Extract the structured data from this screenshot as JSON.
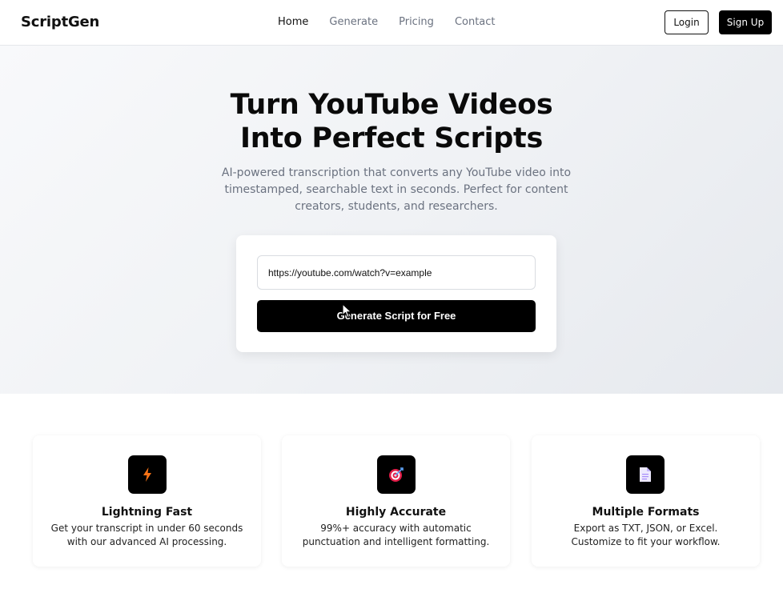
{
  "nav": {
    "brand": "ScriptGen",
    "links": [
      "Home",
      "Generate",
      "Pricing",
      "Contact"
    ],
    "active": "Home",
    "login_label": "Login",
    "signup_label": "Sign Up"
  },
  "hero": {
    "title_line1": "Turn YouTube Videos",
    "title_line2": "Into Perfect Scripts",
    "subtitle": "AI-powered transcription that converts any YouTube video into timestamped, searchable text in seconds. Perfect for content creators, students, and researchers.",
    "input_value": "https://youtube.com/watch?v=example",
    "generate_label": "Generate Script for Free"
  },
  "features": [
    {
      "icon": "lightning-icon",
      "title": "Lightning Fast",
      "description": "Get your transcript in under 60 seconds with our advanced AI processing."
    },
    {
      "icon": "target-icon",
      "title": "Highly Accurate",
      "description": "99%+ accuracy with automatic punctuation and intelligent formatting."
    },
    {
      "icon": "document-icon",
      "title": "Multiple Formats",
      "description": "Export as TXT, JSON, or Excel. Customize to fit your workflow."
    }
  ],
  "colors": {
    "accent": "#000000",
    "muted_text": "#6b7280",
    "lightning": "#f97316",
    "target": "#e11d48",
    "document": "#ddd6fe"
  }
}
